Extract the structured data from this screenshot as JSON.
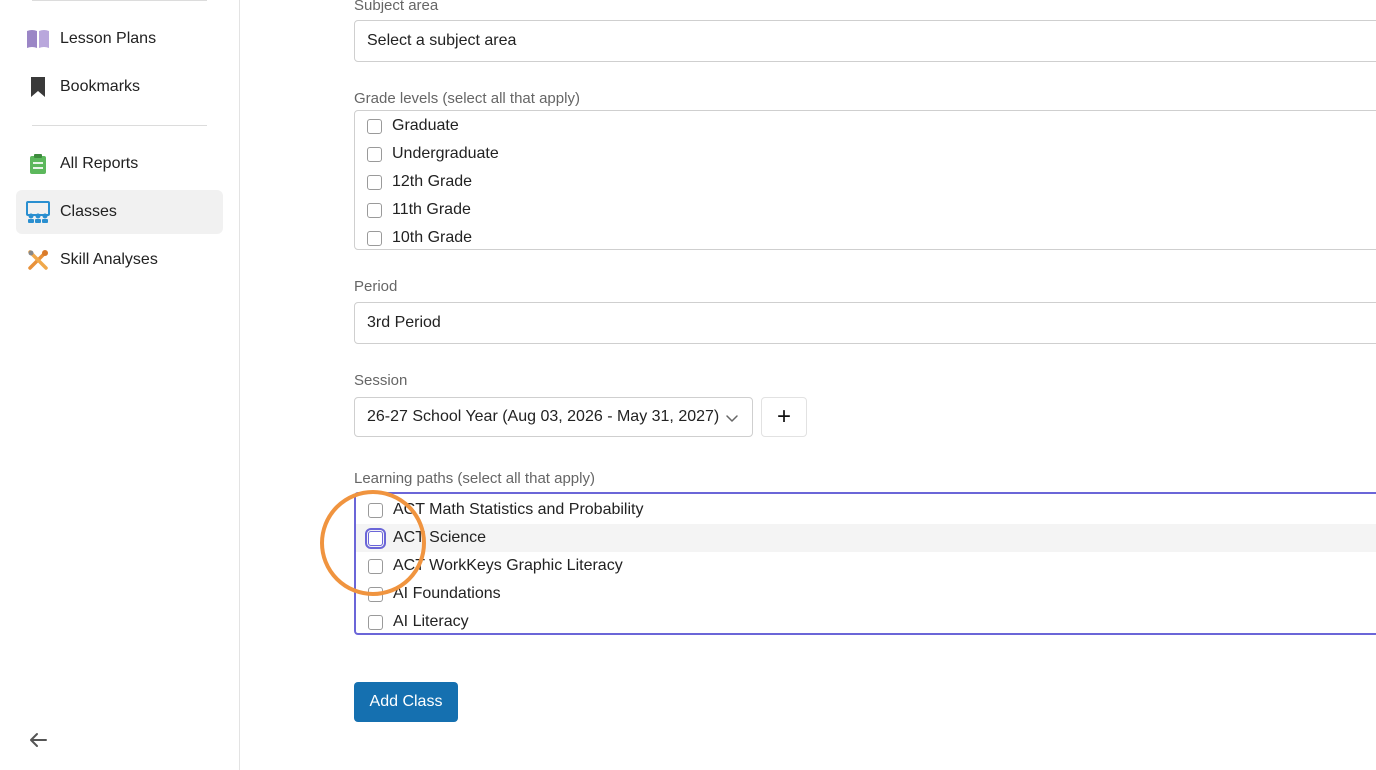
{
  "sidebar": {
    "items": [
      {
        "label": "Lesson Plans",
        "icon": "book-icon"
      },
      {
        "label": "Bookmarks",
        "icon": "bookmark-icon"
      },
      {
        "label": "All Reports",
        "icon": "clipboard-icon"
      },
      {
        "label": "Classes",
        "icon": "classroom-icon"
      },
      {
        "label": "Skill Analyses",
        "icon": "tools-icon"
      }
    ],
    "active": "Classes"
  },
  "form": {
    "subject_area": {
      "label": "Subject area",
      "value": "Select a subject area"
    },
    "grade_levels": {
      "label": "Grade levels (select all that apply)",
      "options": [
        "Graduate",
        "Undergraduate",
        "12th Grade",
        "11th Grade",
        "10th Grade"
      ]
    },
    "period": {
      "label": "Period",
      "value": "3rd Period"
    },
    "session": {
      "label": "Session",
      "value": "26-27 School Year (Aug 03, 2026 - May 31, 2027)",
      "add_label": "+"
    },
    "learning_paths": {
      "label": "Learning paths (select all that apply)",
      "options": [
        "ACT Math Statistics and Probability",
        "ACT Science",
        "ACT WorkKeys Graphic Literacy",
        "AI Foundations",
        "AI Literacy"
      ]
    },
    "submit_label": "Add Class"
  },
  "colors": {
    "accent": "#6b66d8",
    "primary_button": "#1570b0",
    "highlight": "#f0943f"
  }
}
